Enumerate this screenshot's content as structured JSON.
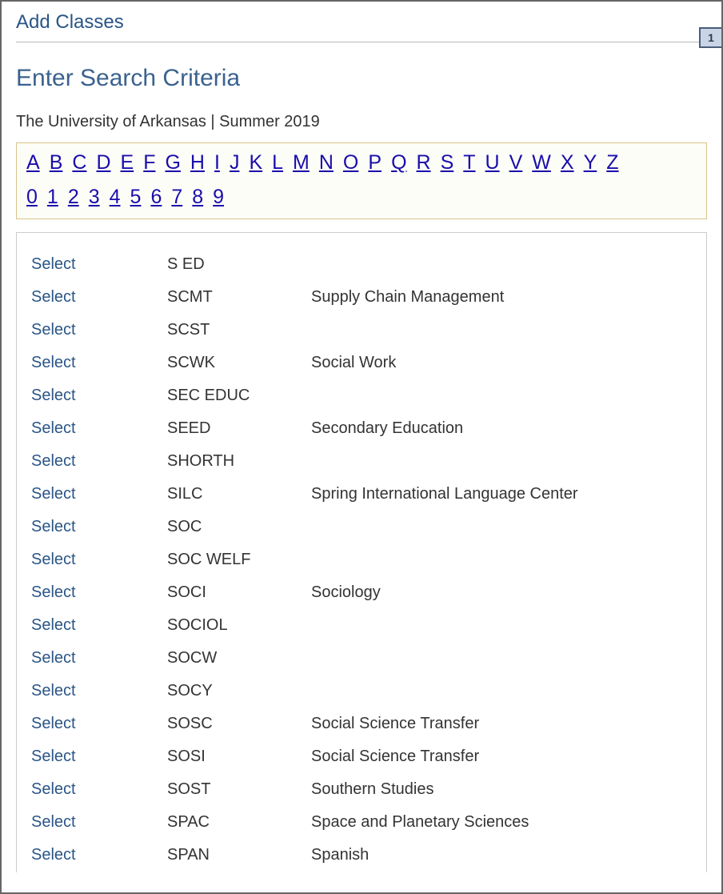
{
  "page": {
    "title": "Add Classes",
    "subtitle": "Enter Search Criteria",
    "context": "The University of Arkansas | Summer 2019",
    "step_badge": "1"
  },
  "alphabet": {
    "letters": [
      "A",
      "B",
      "C",
      "D",
      "E",
      "F",
      "G",
      "H",
      "I",
      "J",
      "K",
      "L",
      "M",
      "N",
      "O",
      "P",
      "Q",
      "R",
      "S",
      "T",
      "U",
      "V",
      "W",
      "X",
      "Y",
      "Z"
    ],
    "digits": [
      "0",
      "1",
      "2",
      "3",
      "4",
      "5",
      "6",
      "7",
      "8",
      "9"
    ]
  },
  "select_label": "Select",
  "results": [
    {
      "code": "S ED",
      "desc": ""
    },
    {
      "code": "SCMT",
      "desc": "Supply Chain Management"
    },
    {
      "code": "SCST",
      "desc": ""
    },
    {
      "code": "SCWK",
      "desc": "Social Work"
    },
    {
      "code": "SEC EDUC",
      "desc": ""
    },
    {
      "code": "SEED",
      "desc": "Secondary Education"
    },
    {
      "code": "SHORTH",
      "desc": ""
    },
    {
      "code": "SILC",
      "desc": "Spring International Language Center"
    },
    {
      "code": "SOC",
      "desc": ""
    },
    {
      "code": "SOC WELF",
      "desc": ""
    },
    {
      "code": "SOCI",
      "desc": "Sociology"
    },
    {
      "code": "SOCIOL",
      "desc": ""
    },
    {
      "code": "SOCW",
      "desc": ""
    },
    {
      "code": "SOCY",
      "desc": ""
    },
    {
      "code": "SOSC",
      "desc": "Social Science Transfer"
    },
    {
      "code": "SOSI",
      "desc": "Social Science Transfer"
    },
    {
      "code": "SOST",
      "desc": "Southern Studies"
    },
    {
      "code": "SPAC",
      "desc": "Space and Planetary Sciences"
    },
    {
      "code": "SPAN",
      "desc": "Spanish"
    }
  ]
}
